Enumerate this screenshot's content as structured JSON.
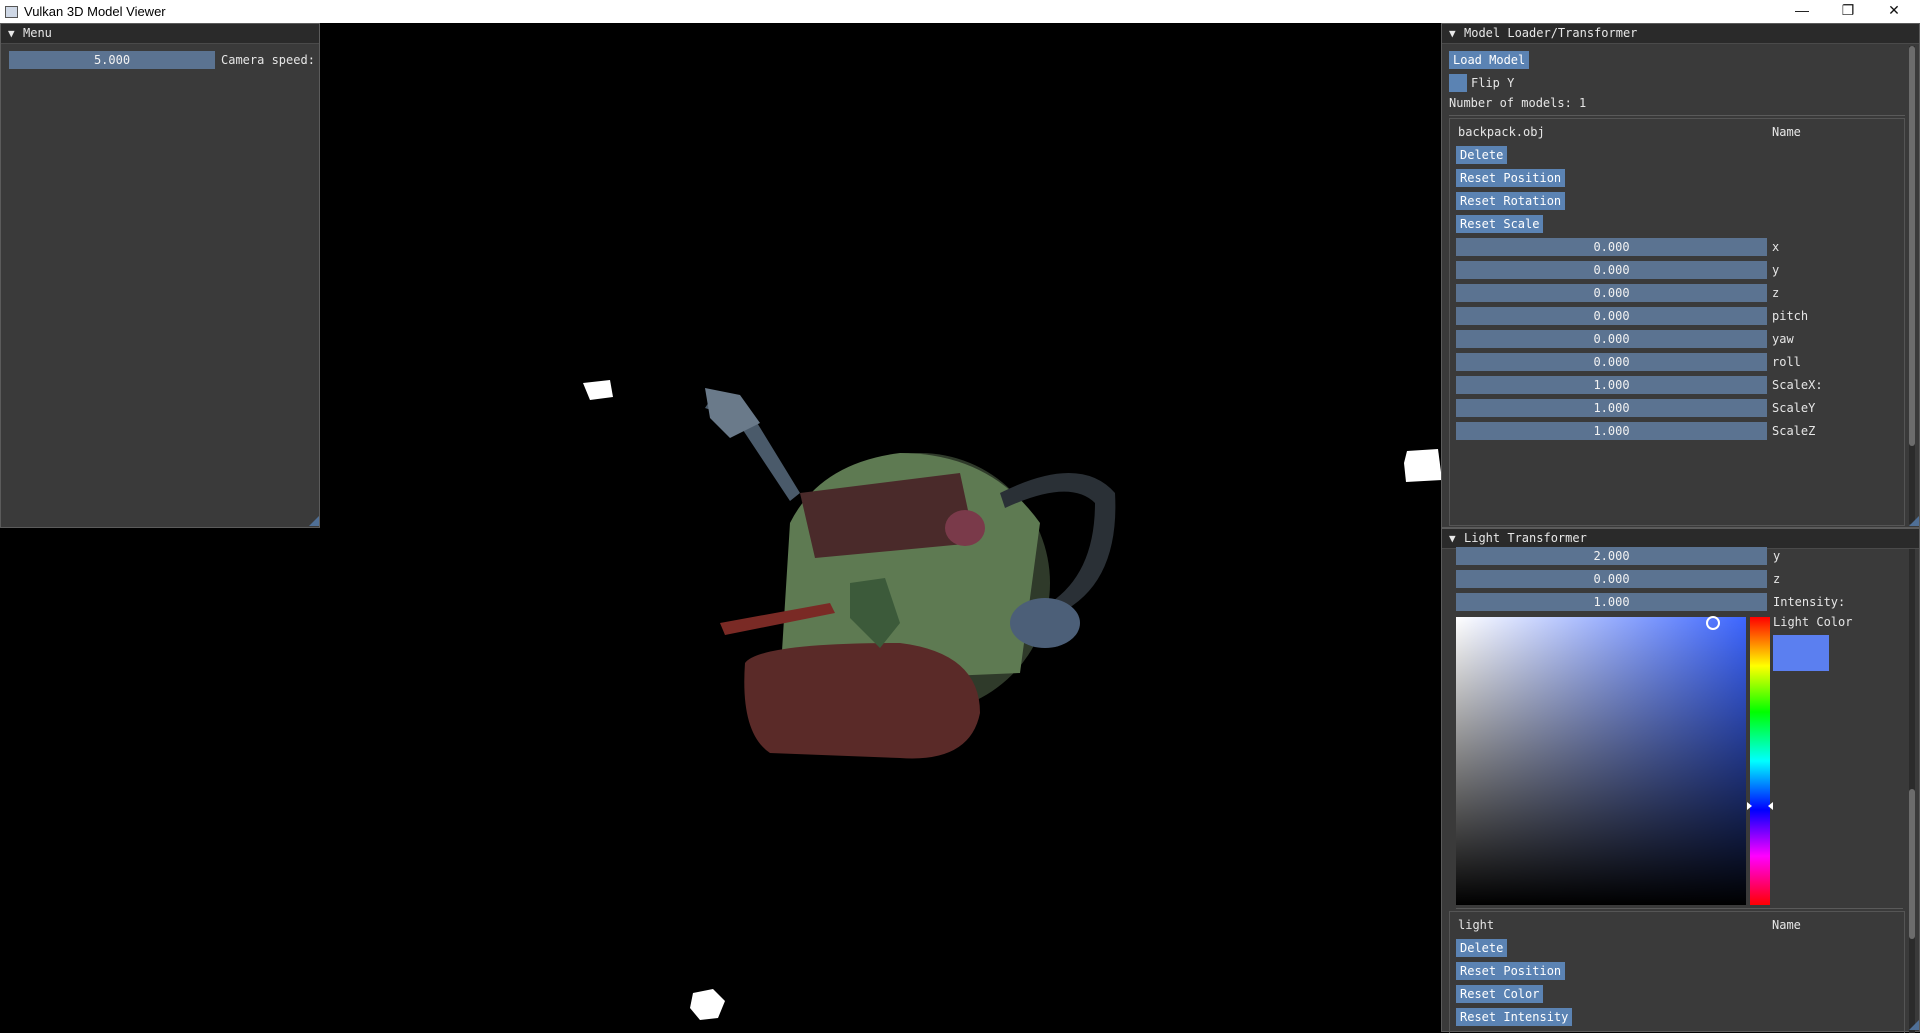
{
  "window": {
    "title": "Vulkan 3D Model Viewer",
    "minimize": "—",
    "maximize": "❐",
    "close": "✕"
  },
  "menu": {
    "title": "Menu",
    "camera_speed_value": "5.000",
    "camera_speed_label": "Camera speed:"
  },
  "model_loader": {
    "title": "Model Loader/Transformer",
    "load_button": "Load Model",
    "flip_label": "Flip Y",
    "count_text": "Number of models: 1",
    "model_name": "backpack.obj",
    "name_label": "Name",
    "delete_button": "Delete",
    "reset_position_button": "Reset Position",
    "reset_rotation_button": "Reset Rotation",
    "reset_scale_button": "Reset Scale",
    "fields": [
      {
        "value": "0.000",
        "label": "x"
      },
      {
        "value": "0.000",
        "label": "y"
      },
      {
        "value": "0.000",
        "label": "z"
      },
      {
        "value": "0.000",
        "label": "pitch"
      },
      {
        "value": "0.000",
        "label": "yaw"
      },
      {
        "value": "0.000",
        "label": "roll"
      },
      {
        "value": "1.000",
        "label": "ScaleX:"
      },
      {
        "value": "1.000",
        "label": "ScaleY"
      },
      {
        "value": "1.000",
        "label": "ScaleZ"
      }
    ]
  },
  "light": {
    "title": "Light Transformer",
    "fields": [
      {
        "value": "2.000",
        "label": "y"
      },
      {
        "value": "0.000",
        "label": "z"
      },
      {
        "value": "1.000",
        "label": "Intensity:"
      }
    ],
    "color_label": "Light Color",
    "color_hex": "#5b7ff0",
    "light_name": "light",
    "name_label": "Name",
    "delete_button": "Delete",
    "reset_position_button": "Reset Position",
    "reset_color_button": "Reset Color",
    "reset_intensity_button": "Reset Intensity"
  }
}
